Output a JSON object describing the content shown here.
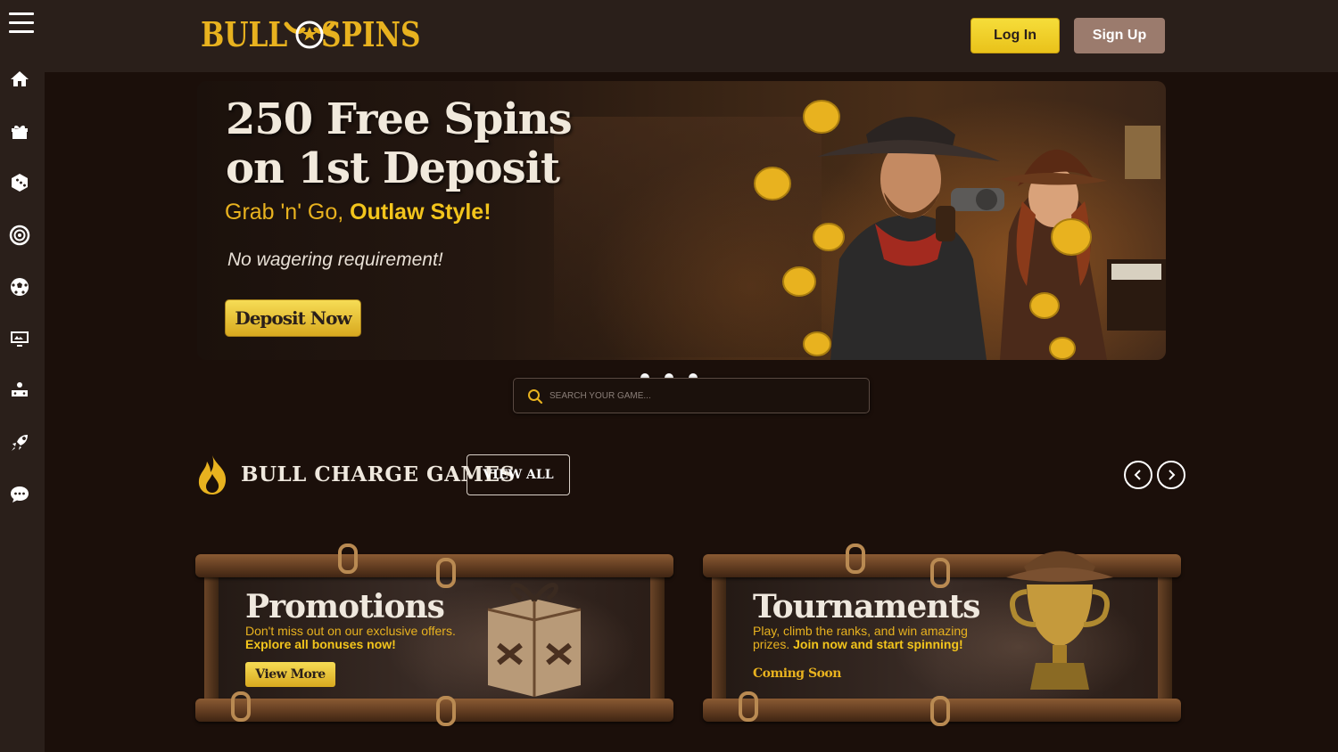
{
  "brand": {
    "name_left": "BULL",
    "name_right": "SPINS",
    "color": "#e8b21f"
  },
  "header": {
    "login_label": "Log In",
    "signup_label": "Sign Up"
  },
  "sidebar": {
    "items": [
      {
        "icon": "home-icon"
      },
      {
        "icon": "gift-icon"
      },
      {
        "icon": "dice-icon"
      },
      {
        "icon": "roulette-icon"
      },
      {
        "icon": "soccer-ball-icon"
      },
      {
        "icon": "live-casino-icon"
      },
      {
        "icon": "gamepad-icon"
      },
      {
        "icon": "rocket-icon"
      },
      {
        "icon": "chat-icon"
      }
    ]
  },
  "hero": {
    "title_line1": "250 Free Spins",
    "title_line2": "on 1st Deposit",
    "subtitle_plain": "Grab 'n' Go, ",
    "subtitle_bold": "Outlaw Style!",
    "note": "No wagering requirement!",
    "cta_label": "Deposit Now"
  },
  "carousel": {
    "slides": 3
  },
  "search": {
    "placeholder": "SEARCH YOUR GAME..."
  },
  "section": {
    "title": "BULL CHARGE GAMES",
    "view_all_label": "VIEW ALL"
  },
  "cards": [
    {
      "title": "Promotions",
      "desc_plain": "Don't miss out on our exclusive offers.",
      "desc_bold": "Explore all bonuses now!",
      "button_label": "View More"
    },
    {
      "title": "Tournaments",
      "desc_plain": "Play, climb the ranks, and win amazing prizes. ",
      "desc_bold": "Join now and start spinning!",
      "status_label": "Coming Soon"
    }
  ],
  "colors": {
    "accent": "#f3c51c",
    "background": "#1b0f0a",
    "panel": "#2a1f1a",
    "signup": "#9b7b6d"
  }
}
